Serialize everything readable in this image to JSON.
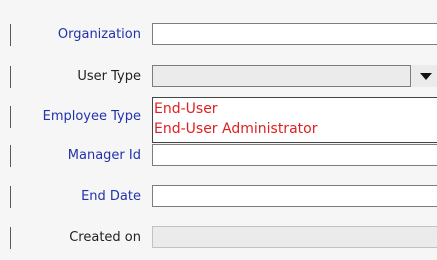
{
  "form": {
    "organization": {
      "label": "Organization",
      "value": ""
    },
    "user_type": {
      "label": "User Type",
      "value": ""
    },
    "employee_type": {
      "label": "Employee Type",
      "value": ""
    },
    "manager_id": {
      "label": "Manager Id",
      "value": ""
    },
    "end_date": {
      "label": "End Date",
      "value": ""
    },
    "created_on": {
      "label": "Created on",
      "value": ""
    }
  },
  "user_type_dropdown": {
    "options": [
      "End-User",
      "End-User Administrator"
    ]
  },
  "colors": {
    "required_label": "#2233aa",
    "option_text": "#e02020",
    "panel_bg": "#f6f6f6"
  },
  "icons": {
    "dropdown_toggle": "triangle-down-icon"
  }
}
